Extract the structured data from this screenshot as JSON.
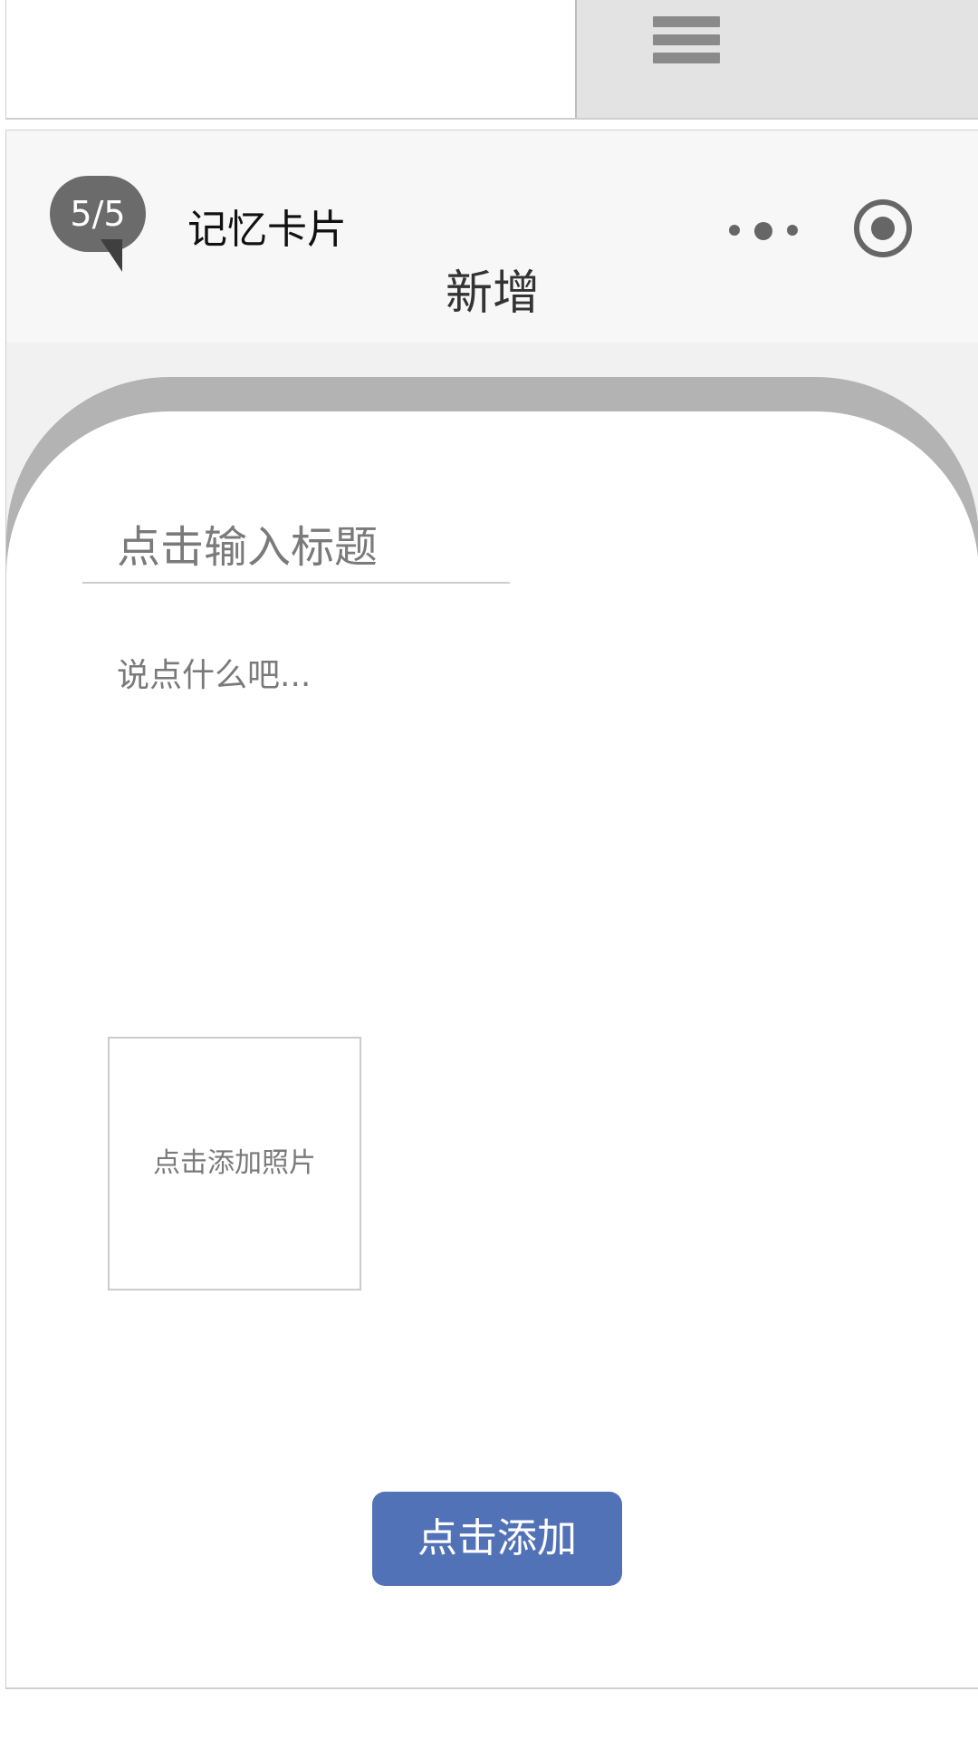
{
  "top_bar": {
    "menu_icon": "hamburger-menu-icon"
  },
  "nav": {
    "badge_text": "5/5",
    "app_name": "记忆卡片",
    "more_icon": "more-dots-icon",
    "target_icon": "target-circle-icon"
  },
  "page": {
    "title": "新增"
  },
  "form": {
    "title_placeholder": "点击输入标题",
    "content_placeholder": "说点什么吧...",
    "photo_label": "点击添加照片",
    "submit_label": "点击添加"
  },
  "colors": {
    "primary_button": "#5272b7",
    "card_shadow": "#b3b3b3",
    "background": "#f1f1f1"
  }
}
